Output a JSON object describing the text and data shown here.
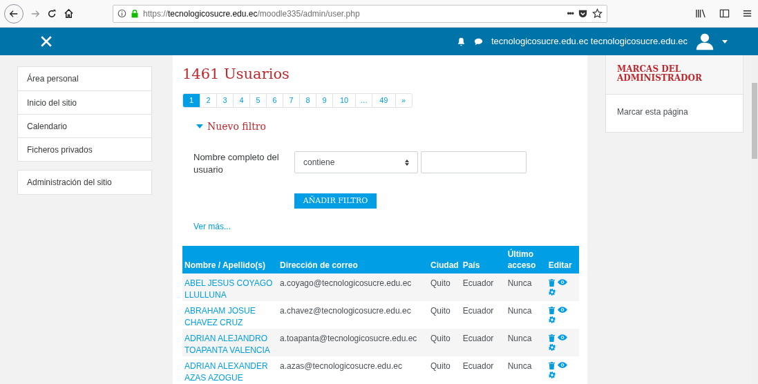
{
  "browser": {
    "url_scheme": "https://",
    "url_host": "tecnologicosucre.edu.ec",
    "url_path": "/moodle335/admin/user.php",
    "menu_glyph": "•••"
  },
  "navbar": {
    "user_name": "tecnologicosucre.edu.ec tecnologicosucre.edu.ec"
  },
  "sidebar": {
    "sections": [
      {
        "items": [
          "Área personal",
          "Inicio del sitio",
          "Calendario",
          "Ficheros privados"
        ]
      },
      {
        "items": [
          "Administración del sitio"
        ]
      }
    ]
  },
  "title": "1461 Usuarios",
  "pagination": [
    {
      "label": "1",
      "selected": true
    },
    {
      "label": "2",
      "selected": false
    },
    {
      "label": "3",
      "selected": false
    },
    {
      "label": "4",
      "selected": false
    },
    {
      "label": "5",
      "selected": false
    },
    {
      "label": "6",
      "selected": false
    },
    {
      "label": "7",
      "selected": false
    },
    {
      "label": "8",
      "selected": false
    },
    {
      "label": "9",
      "selected": false
    },
    {
      "label": "10",
      "selected": false
    },
    {
      "label": "…",
      "selected": false
    },
    {
      "label": "49",
      "selected": false
    },
    {
      "label": "»",
      "selected": false
    }
  ],
  "filter": {
    "title": "Nuevo filtro",
    "expanded": true,
    "field_label": "Nombre completo del usuario",
    "operator": "contiene",
    "button": "AÑADIR FILTRO",
    "more_link": "Ver más..."
  },
  "table": {
    "columns": [
      "Nombre / Apellido(s)",
      "Dirección de correo",
      "Ciudad",
      "País",
      "Último acceso",
      "Editar"
    ],
    "rows": [
      {
        "name": "ABEL JESUS COYAGO LLULLUNA",
        "email": "a.coyago@tecnologicosucre.edu.ec",
        "city": "Quito",
        "country": "Ecuador",
        "last_access": "Nunca"
      },
      {
        "name": "ABRAHAM JOSUE CHAVEZ CRUZ",
        "email": "a.chavez@tecnologicosucre.edu.ec",
        "city": "Quito",
        "country": "Ecuador",
        "last_access": "Nunca"
      },
      {
        "name": "ADRIAN ALEJANDRO TOAPANTA VALENCIA",
        "email": "a.toapanta@tecnologicosucre.edu.ec",
        "city": "Quito",
        "country": "Ecuador",
        "last_access": "Nunca"
      },
      {
        "name": "ADRIAN ALEXANDER AZAS AZOGUE",
        "email": "a.azas@tecnologicosucre.edu.ec",
        "city": "Quito",
        "country": "Ecuador",
        "last_access": "Nunca"
      }
    ]
  },
  "admin_block": {
    "title": "MARCAS DEL ADMINISTRADOR",
    "items": [
      "Marcar esta página"
    ]
  }
}
